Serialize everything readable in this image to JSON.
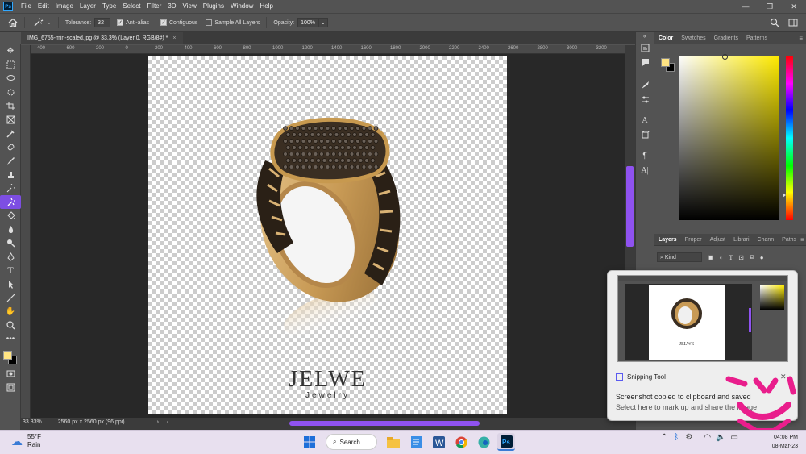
{
  "app": {
    "logo": "Ps"
  },
  "menu": [
    "File",
    "Edit",
    "Image",
    "Layer",
    "Type",
    "Select",
    "Filter",
    "3D",
    "View",
    "Plugins",
    "Window",
    "Help"
  ],
  "window_controls": {
    "minimize": "—",
    "restore": "❐",
    "close": "✕"
  },
  "options": {
    "tolerance_label": "Tolerance:",
    "tolerance_value": "32",
    "anti_alias_label": "Anti-alias",
    "anti_alias_checked": true,
    "contiguous_label": "Contiguous",
    "contiguous_checked": true,
    "sample_all_label": "Sample All Layers",
    "sample_all_checked": false,
    "opacity_label": "Opacity:",
    "opacity_value": "100%"
  },
  "document": {
    "tab_title": "IMG_6755-min-scaled.jpg @ 33.3% (Layer 0, RGB/8#) *",
    "tab_close": "×",
    "brand_name": "JELWE",
    "brand_sub": "Jewelry"
  },
  "ruler_labels": [
    "400",
    "600",
    "200",
    "0",
    "200",
    "400",
    "600",
    "800",
    "1000",
    "1200",
    "1400",
    "1600",
    "1800",
    "2000",
    "2200",
    "2400",
    "2600",
    "2800",
    "3000",
    "3200"
  ],
  "status": {
    "zoom": "33.33%",
    "dimensions": "2560 px x 2560 px (96 ppi)"
  },
  "panels": {
    "color_tabs": [
      "Color",
      "Swatches",
      "Gradients",
      "Patterns"
    ],
    "layer_tabs": [
      "Layers",
      "Proper",
      "Adjust",
      "Librari",
      "Chann",
      "Paths"
    ],
    "kind_label": "Kind",
    "fg_color": "#ffe483",
    "bg_color": "#000000",
    "accent": "#8f52f0"
  },
  "toast": {
    "app_name": "Snipping Tool",
    "line1": "Screenshot copied to clipboard and saved",
    "line2": "Select here to mark up and share the image",
    "close": "✕"
  },
  "taskbar": {
    "temp": "55°F",
    "condition": "Rain",
    "search_label": "Search",
    "time": "04:08 PM",
    "date": "08-Mar-23"
  }
}
